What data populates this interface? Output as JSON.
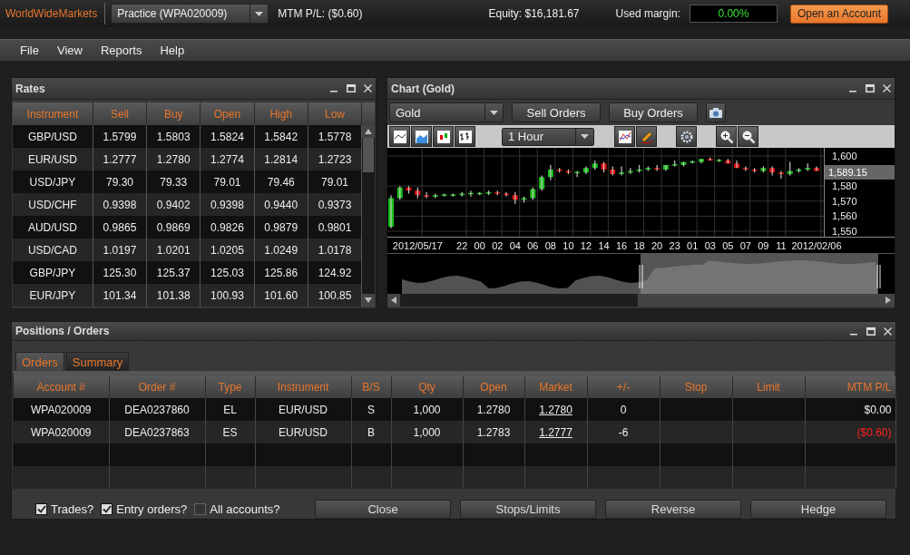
{
  "top_bar": {
    "logo": "WorldWideMarkets",
    "account_select": "Practice (WPA020009)",
    "mtm_pl": "MTM P/L: ($0.60)",
    "equity": "Equity: $16,181.67",
    "used_margin_label": "Used margin:",
    "used_margin_value": "0.00%",
    "open_account_button": "Open an Account"
  },
  "menu": [
    "File",
    "View",
    "Reports",
    "Help"
  ],
  "rates": {
    "title": "Rates",
    "columns": [
      "Instrument",
      "Sell",
      "Buy",
      "Open",
      "High",
      "Low"
    ],
    "rows": [
      [
        "GBP/USD",
        "1.5799",
        "1.5803",
        "1.5824",
        "1.5842",
        "1.5778"
      ],
      [
        "EUR/USD",
        "1.2777",
        "1.2780",
        "1.2774",
        "1.2814",
        "1.2723"
      ],
      [
        "USD/JPY",
        "79.30",
        "79.33",
        "79.01",
        "79.46",
        "79.01"
      ],
      [
        "USD/CHF",
        "0.9398",
        "0.9402",
        "0.9398",
        "0.9440",
        "0.9373"
      ],
      [
        "AUD/USD",
        "0.9865",
        "0.9869",
        "0.9826",
        "0.9879",
        "0.9801"
      ],
      [
        "USD/CAD",
        "1.0197",
        "1.0201",
        "1.0205",
        "1.0249",
        "1.0178"
      ],
      [
        "GBP/JPY",
        "125.30",
        "125.37",
        "125.03",
        "125.86",
        "124.92"
      ],
      [
        "EUR/JPY",
        "101.34",
        "101.38",
        "100.93",
        "101.60",
        "100.85"
      ]
    ]
  },
  "chart": {
    "title": "Chart (Gold)",
    "instrument_select": "Gold",
    "buttons": [
      "Sell Orders",
      "Buy Orders"
    ],
    "interval_select": "1 Hour",
    "current_price": "1,589.15",
    "chart_data": {
      "type": "candlestick",
      "grid": true,
      "ylim": [
        1547.6,
        1605.4
      ],
      "yticks": [
        {
          "value": 1600,
          "label": "1,600"
        },
        {
          "value": 1580,
          "label": "1,580"
        },
        {
          "value": 1570,
          "label": "1,570"
        },
        {
          "value": 1560,
          "label": "1,560"
        },
        {
          "value": 1550,
          "label": "1,550"
        }
      ],
      "categories": [
        null,
        null,
        null,
        "2012/05/17",
        null,
        null,
        null,
        null,
        "22",
        null,
        "00",
        null,
        "02",
        null,
        "04",
        null,
        "06",
        null,
        "08",
        null,
        "10",
        null,
        "12",
        null,
        "14",
        null,
        "16",
        null,
        "18",
        null,
        "20",
        null,
        "23",
        null,
        "01",
        null,
        "03",
        null,
        "05",
        null,
        "07",
        null,
        "09",
        null,
        "11",
        null,
        null,
        null,
        "2012/02/06"
      ],
      "ohlc": [
        [
          1553,
          1574,
          1552,
          1572
        ],
        [
          1572,
          1580,
          1571,
          1579
        ],
        [
          1579,
          1580,
          1575,
          1577
        ],
        [
          1577,
          1579,
          1572,
          1574
        ],
        [
          1574,
          1576,
          1572,
          1573
        ],
        [
          1573,
          1575,
          1572,
          1574
        ],
        [
          1574,
          1575,
          1573,
          1574
        ],
        [
          1574,
          1575,
          1573,
          1574
        ],
        [
          1574,
          1576,
          1573,
          1575
        ],
        [
          1575,
          1577,
          1573,
          1575
        ],
        [
          1575,
          1576,
          1574,
          1575
        ],
        [
          1575,
          1577,
          1574,
          1576
        ],
        [
          1576,
          1577,
          1574,
          1575
        ],
        [
          1575,
          1576,
          1573,
          1574
        ],
        [
          1574,
          1576,
          1568,
          1571
        ],
        [
          1571,
          1573,
          1569,
          1572
        ],
        [
          1572,
          1579,
          1571,
          1578
        ],
        [
          1578,
          1587,
          1577,
          1586
        ],
        [
          1586,
          1594,
          1584,
          1591
        ],
        [
          1591,
          1592,
          1589,
          1590
        ],
        [
          1590,
          1591,
          1588,
          1589
        ],
        [
          1589,
          1590,
          1586,
          1589
        ],
        [
          1589,
          1593,
          1588,
          1592
        ],
        [
          1592,
          1597,
          1591,
          1595
        ],
        [
          1595,
          1596,
          1589,
          1591
        ],
        [
          1591,
          1593,
          1587,
          1588
        ],
        [
          1588,
          1593,
          1587,
          1589
        ],
        [
          1589,
          1592,
          1588,
          1590
        ],
        [
          1590,
          1594,
          1589,
          1591
        ],
        [
          1591,
          1593,
          1590,
          1592
        ],
        [
          1592,
          1594,
          1590,
          1591
        ],
        [
          1591,
          1594,
          1590,
          1594
        ],
        [
          1594,
          1597,
          1593,
          1594
        ],
        [
          1594,
          1596,
          1593,
          1596
        ],
        [
          1596,
          1597,
          1595,
          1596
        ],
        [
          1596,
          1598,
          1595,
          1598
        ],
        [
          1598,
          1599,
          1597,
          1597
        ],
        [
          1597,
          1598,
          1596,
          1597
        ],
        [
          1597,
          1598,
          1595,
          1595
        ],
        [
          1595,
          1597,
          1592,
          1592
        ],
        [
          1592,
          1593,
          1590,
          1591
        ],
        [
          1591,
          1592,
          1589,
          1590
        ],
        [
          1590,
          1593,
          1589,
          1592
        ],
        [
          1592,
          1593,
          1587,
          1589
        ],
        [
          1589,
          1590,
          1585,
          1588
        ],
        [
          1588,
          1596,
          1587,
          1590
        ],
        [
          1590,
          1592,
          1589,
          1591
        ],
        [
          1591,
          1595,
          1590,
          1592
        ],
        [
          1592,
          1593,
          1590,
          1590
        ]
      ]
    }
  },
  "positions": {
    "title": "Positions / Orders",
    "tabs": [
      {
        "label": "Orders",
        "selected": true
      },
      {
        "label": "Summary",
        "selected": false
      }
    ],
    "columns": [
      "Account #",
      "Order #",
      "Type",
      "Instrument",
      "B/S",
      "Qty",
      "Open",
      "Market",
      "+/-",
      "Stop",
      "Limit",
      "MTM P/L"
    ],
    "rows": [
      {
        "account": "WPA020009",
        "order": "DEA0237860",
        "type": "EL",
        "instrument": "EUR/USD",
        "bs": "S",
        "qty": "1,000",
        "open": "1.2780",
        "market": "1.2780",
        "change": "0",
        "mtm": "$0.00",
        "loss": false
      },
      {
        "account": "WPA020009",
        "order": "DEA0237863",
        "type": "ES",
        "instrument": "EUR/USD",
        "bs": "B",
        "qty": "1,000",
        "open": "1.2783",
        "market": "1.2777",
        "change": "-6",
        "mtm": "($0.60)",
        "loss": true
      }
    ],
    "filters": [
      {
        "label": "Trades?",
        "checked": true
      },
      {
        "label": "Entry orders?",
        "checked": true
      },
      {
        "label": "All accounts?",
        "checked": false
      }
    ],
    "actions": [
      "Close",
      "Stops/Limits",
      "Reverse",
      "Hedge"
    ]
  }
}
